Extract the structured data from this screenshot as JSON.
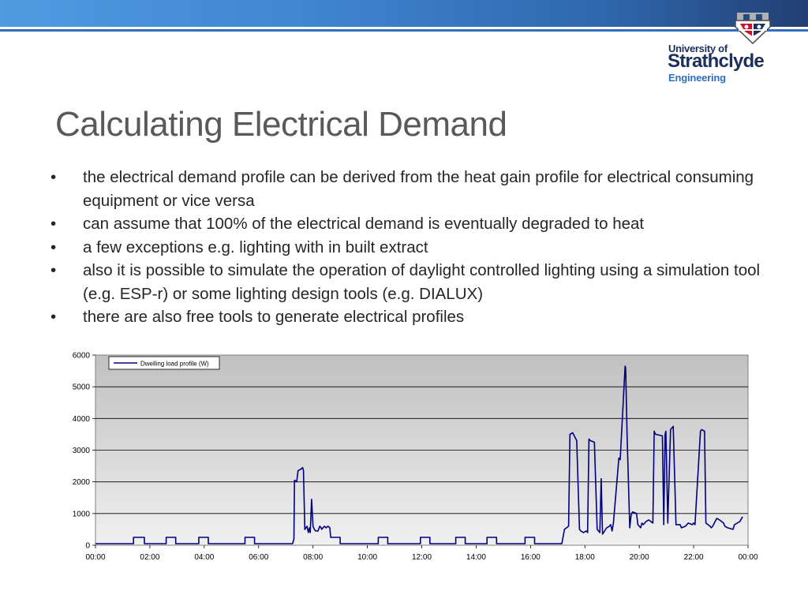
{
  "slide": {
    "title": "Calculating Electrical Demand",
    "bullet_marker": "•",
    "bullets": [
      "the electrical demand profile can be derived from the heat gain profile for electrical consuming equipment or vice versa",
      "can assume that 100% of the electrical demand is eventually degraded to heat",
      "a few exceptions e.g. lighting with in built extract",
      "also it is possible to simulate the operation of daylight controlled lighting using a simulation tool (e.g. ESP-r) or some lighting design tools (e.g. DIALUX)",
      "there are also free tools to generate electrical profiles"
    ]
  },
  "logo": {
    "line1": "University of",
    "line2": "Strathclyde",
    "line3": "Engineering"
  },
  "colors": {
    "brand_navy": "#1b2e5c",
    "brand_blue": "#2f6fbd",
    "series_line": "#000080",
    "plot_bg_top": "#c0c0c0",
    "plot_bg_bottom": "#f0f0f0"
  },
  "chart_data": {
    "type": "line",
    "title": "",
    "xlabel": "",
    "ylabel": "",
    "x_ticks": [
      "00:00",
      "02:00",
      "04:00",
      "06:00",
      "08:00",
      "10:00",
      "12:00",
      "14:00",
      "16:00",
      "18:00",
      "20:00",
      "22:00",
      "00:00"
    ],
    "y_ticks": [
      0,
      1000,
      2000,
      3000,
      4000,
      5000,
      6000
    ],
    "ylim": [
      0,
      6000
    ],
    "xlim_hours": [
      0,
      24
    ],
    "grid": true,
    "legend": {
      "position": "top-left",
      "entries": [
        "Dwelling load profile (W)"
      ]
    },
    "series": [
      {
        "name": "Dwelling load profile (W)",
        "x_hours": [
          0,
          1.4,
          1.4,
          1.8,
          1.8,
          2.6,
          2.6,
          2.95,
          2.95,
          3.8,
          3.8,
          4.15,
          4.15,
          5.5,
          5.5,
          5.85,
          5.85,
          7.25,
          7.3,
          7.32,
          7.4,
          7.45,
          7.55,
          7.62,
          7.65,
          7.7,
          7.78,
          7.83,
          7.87,
          7.9,
          7.95,
          8.0,
          8.05,
          8.1,
          8.18,
          8.25,
          8.3,
          8.32,
          8.42,
          8.48,
          8.55,
          8.62,
          8.65,
          9.0,
          9.0,
          10.4,
          10.4,
          10.75,
          10.75,
          11.95,
          11.95,
          12.3,
          12.3,
          13.25,
          13.25,
          13.6,
          13.6,
          14.4,
          14.4,
          14.75,
          14.75,
          15.8,
          15.8,
          16.15,
          16.15,
          17.15,
          17.25,
          17.4,
          17.45,
          17.55,
          17.7,
          17.8,
          17.85,
          17.95,
          18.05,
          18.1,
          18.15,
          18.2,
          18.35,
          18.45,
          18.55,
          18.6,
          18.65,
          18.8,
          18.9,
          18.95,
          19.0,
          19.05,
          19.25,
          19.3,
          19.48,
          19.5,
          19.55,
          19.65,
          19.7,
          19.75,
          19.9,
          19.95,
          20.05,
          20.1,
          20.15,
          20.25,
          20.35,
          20.5,
          20.55,
          20.6,
          20.85,
          20.9,
          20.95,
          20.98,
          21.05,
          21.15,
          21.2,
          21.25,
          21.35,
          21.5,
          21.55,
          21.7,
          21.75,
          21.8,
          21.95,
          22.0,
          22.05,
          22.25,
          22.3,
          22.4,
          22.45,
          22.6,
          22.65,
          22.7,
          22.85,
          22.95,
          23.1,
          23.15,
          23.25,
          23.45,
          23.5,
          23.7,
          23.8,
          23.9,
          24.0
        ],
        "values": [
          50,
          50,
          250,
          250,
          50,
          50,
          250,
          250,
          50,
          50,
          250,
          250,
          50,
          50,
          250,
          250,
          50,
          50,
          200,
          2050,
          2000,
          2350,
          2400,
          2450,
          2350,
          500,
          600,
          400,
          550,
          400,
          1450,
          600,
          500,
          450,
          450,
          600,
          550,
          500,
          600,
          550,
          600,
          550,
          250,
          250,
          50,
          50,
          250,
          250,
          50,
          50,
          250,
          250,
          50,
          50,
          250,
          250,
          50,
          50,
          250,
          250,
          50,
          50,
          250,
          250,
          50,
          50,
          500,
          600,
          3500,
          3550,
          3300,
          500,
          450,
          400,
          450,
          400,
          3350,
          3300,
          3250,
          500,
          400,
          2100,
          350,
          550,
          600,
          650,
          450,
          700,
          2750,
          2700,
          5650,
          5600,
          3500,
          550,
          950,
          1050,
          1000,
          650,
          550,
          700,
          650,
          750,
          800,
          700,
          3600,
          3500,
          3450,
          650,
          3500,
          3600,
          700,
          3650,
          3700,
          3750,
          650,
          650,
          550,
          600,
          650,
          700,
          650,
          700,
          650,
          3600,
          3650,
          3600,
          700,
          600,
          550,
          600,
          850,
          800,
          700,
          600,
          550,
          500,
          650,
          750,
          900
        ]
      }
    ]
  }
}
